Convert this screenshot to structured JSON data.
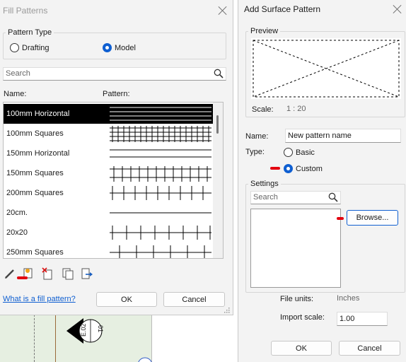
{
  "fill_patterns": {
    "title": "Fill Patterns",
    "pattern_type": {
      "legend": "Pattern Type",
      "drafting_label": "Drafting",
      "model_label": "Model",
      "selected": "Model"
    },
    "search_placeholder": "Search",
    "col_name": "Name:",
    "col_pattern": "Pattern:",
    "rows": [
      {
        "name": "100mm Horizontal",
        "selected": true
      },
      {
        "name": "100mm Squares",
        "selected": false
      },
      {
        "name": "150mm Horizontal",
        "selected": false
      },
      {
        "name": "150mm Squares",
        "selected": false
      },
      {
        "name": "200mm Squares",
        "selected": false
      },
      {
        "name": "20cm.",
        "selected": false
      },
      {
        "name": "20x20",
        "selected": false
      },
      {
        "name": "250mm Squares",
        "selected": false
      }
    ],
    "tools": [
      "edit-pencil-icon",
      "new-pattern-icon",
      "delete-pattern-icon",
      "duplicate-icon",
      "export-icon"
    ],
    "help_link": "What is a fill pattern?",
    "ok_label": "OK",
    "cancel_label": "Cancel"
  },
  "add_surface_pattern": {
    "title": "Add Surface Pattern",
    "preview_legend": "Preview",
    "scale_label": "Scale:",
    "scale_value": "1 : 20",
    "name_label": "Name:",
    "name_value": "New pattern name",
    "type_label": "Type:",
    "basic_label": "Basic",
    "custom_label": "Custom",
    "type_selected": "Custom",
    "settings_legend": "Settings",
    "search_placeholder": "Search",
    "browse_label": "Browse...",
    "file_units_label": "File units:",
    "file_units_value": "Inches",
    "import_scale_label": "Import scale:",
    "import_scale_value": "1.00",
    "ok_label": "OK",
    "cancel_label": "Cancel"
  },
  "background": {
    "tag_text": "E.02",
    "tag_number": "01"
  },
  "colors": {
    "accent": "#0f5fd1",
    "annotation_red": "#e3000f",
    "selected_row": "#000000",
    "drawing_green": "#e6efe1"
  }
}
